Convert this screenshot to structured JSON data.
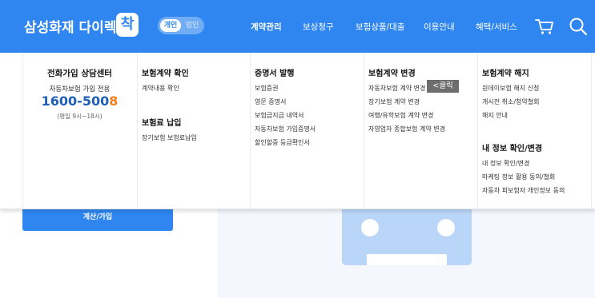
{
  "header": {
    "logo_text": "삼성화재 다이렉트",
    "logo_mark": "착",
    "toggle": {
      "active": "개인",
      "inactive": "법인"
    },
    "nav": [
      "계약관리",
      "보상청구",
      "보험상품/대출",
      "이용안내",
      "혜택/서비스"
    ],
    "icons": [
      "cart-icon",
      "search-icon"
    ],
    "brand_color": "#2f86f0"
  },
  "customer_center": {
    "title": "전화가입 상담센터",
    "subtitle": "자동차보험 가입 전용",
    "phone_main": "1600-500",
    "phone_last": "8",
    "hours": "(평일 9시~18시)"
  },
  "menu": {
    "contract_check": {
      "title": "보험계약 확인",
      "links": [
        "계약내용 확인"
      ]
    },
    "premium_payment": {
      "title": "보험료 납입",
      "links": [
        "장기보험 보험료납입"
      ]
    },
    "certificates": {
      "title": "증명서 발행",
      "links": [
        "보험증권",
        "영문 증명서",
        "보험금지급 내역서",
        "자동차보험 가입증명서",
        "할인할증 등급확인서"
      ]
    },
    "contract_change": {
      "title": "보험계약 변경",
      "links": [
        "자동차보험 계약 변경",
        "장기보험 계약 변경",
        "여행/유학보험 계약 변경",
        "자영업자 종합보험 계약 변경"
      ],
      "click_tag": "<클릭"
    },
    "contract_cancel": {
      "title": "보험계약 해지",
      "links": [
        "원데이보험 해지 신청",
        "개시전 취소/청약철회",
        "해지 안내"
      ]
    },
    "my_info": {
      "title": "내 정보 확인/변경",
      "links": [
        "내 정보 확인/변경",
        "마케팅 정보 활용 동의/철회",
        "자동차 피보험자 개인정보 동의"
      ]
    }
  },
  "background": {
    "calc_button": "계산/가입"
  }
}
